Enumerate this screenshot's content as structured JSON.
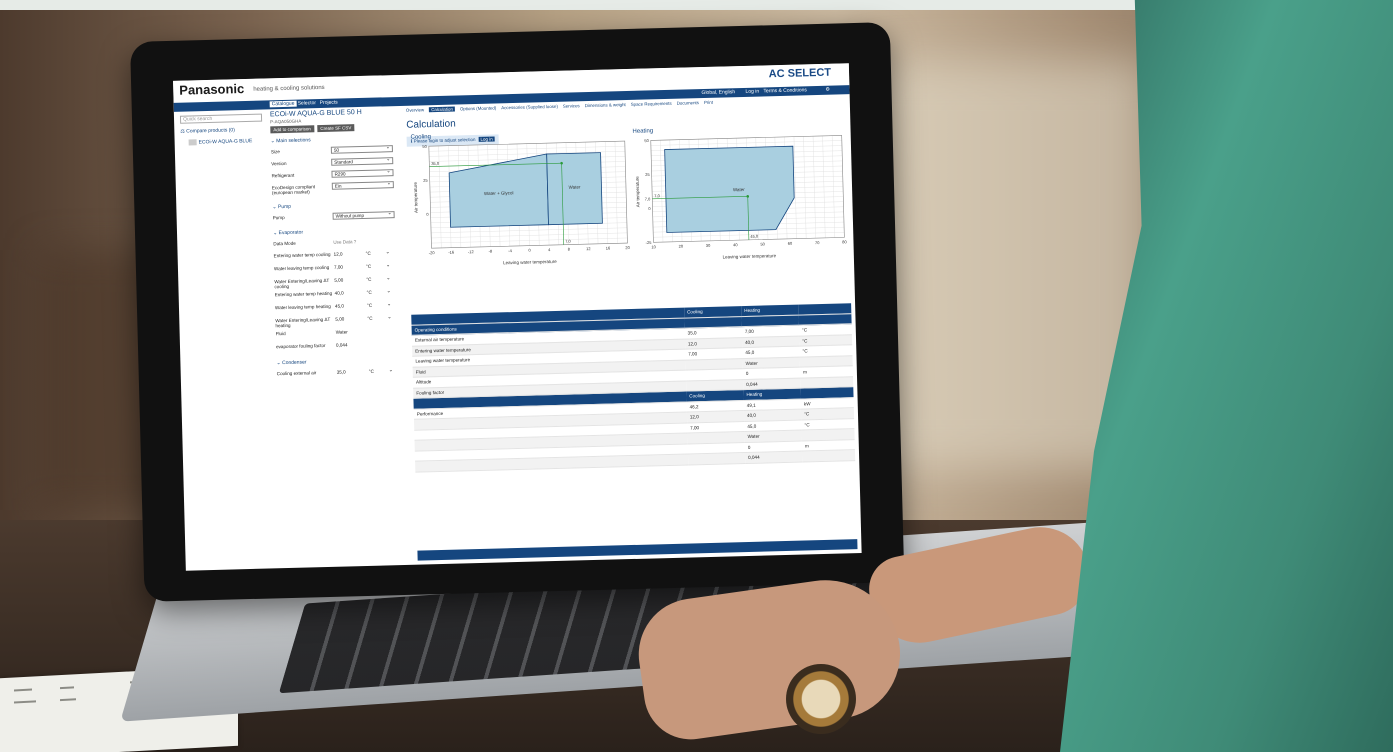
{
  "brand": {
    "logo": "Panasonic",
    "tagline": "heating & cooling solutions",
    "app_name": "AC SELECT"
  },
  "top_nav": {
    "tabs": [
      "Catalogue",
      "Selector",
      "Projects"
    ],
    "right_links": [
      "Global, English",
      "Log in",
      "Terms & Conditions"
    ]
  },
  "left_panel": {
    "search_placeholder": "Quick search",
    "compare_link": "Compare products (0)",
    "product_item": "ECOi-W AQUA-G BLUE"
  },
  "product": {
    "title": "ECOi-W AQUA-G BLUE 50 H",
    "code": "P-AQA050GHA",
    "buttons": [
      "Add to comparison",
      "Create SF CSV"
    ],
    "main_section": "Main selections",
    "fields": [
      {
        "label": "Size",
        "value": "50"
      },
      {
        "label": "Version",
        "value": "Standard"
      },
      {
        "label": "Refrigerant",
        "value": "R290"
      },
      {
        "label": "EcoDesign compliant (european market)",
        "value": "Ein"
      }
    ],
    "pump_section": "Pump",
    "pump": {
      "label": "Pump",
      "value": "Without pump"
    },
    "evaporator_section": "Evaporator",
    "evaporator_header": {
      "label": "Data Mode",
      "value": "Use Data ?"
    },
    "evaporator_rows": [
      {
        "label": "Entering water temp cooling",
        "value": "12,0",
        "unit": "°C"
      },
      {
        "label": "Water leaving temp cooling",
        "value": "7,00",
        "unit": "°C"
      },
      {
        "label": "Water Entering/Leaving ΔT cooling",
        "value": "5,00",
        "unit": "°C"
      },
      {
        "label": "Entering water temp heating",
        "value": "40,0",
        "unit": "°C"
      },
      {
        "label": "Water leaving temp heating",
        "value": "45,0",
        "unit": "°C"
      },
      {
        "label": "Water Entering/Leaving ΔT heating",
        "value": "5,00",
        "unit": "°C"
      },
      {
        "label": "Fluid",
        "value": "Water",
        "unit": ""
      },
      {
        "label": "evaporator fouling factor",
        "value": "0,044",
        "unit": ""
      }
    ],
    "condenser_section": "Condenser",
    "condenser_rows": [
      {
        "label": "Cooling external air",
        "value": "35,0",
        "unit": "°C"
      }
    ]
  },
  "main_tabs": [
    "Overview",
    "Calculation",
    "Options (Mounted)",
    "Accessories (Supplied loose)",
    "Services",
    "Dimensions & weight",
    "Space Requirements",
    "Documents",
    "Print"
  ],
  "active_tab": "Calculation",
  "calculation": {
    "heading": "Calculation",
    "login_notice": "Please login to adjust selection",
    "login_button": "Log in"
  },
  "chart_data": [
    {
      "type": "area",
      "title": "Cooling",
      "xlabel": "Leaving water temperature",
      "ylabel": "Air temperature",
      "xlim": [
        -20,
        20
      ],
      "ylim": [
        -25,
        50
      ],
      "x_ticks": [
        "-20",
        "-16",
        "-12",
        "-8",
        "-4",
        "0",
        "4",
        "8",
        "12",
        "16",
        "20"
      ],
      "y_ticks": [
        "50",
        "25",
        "0"
      ],
      "y_marker_label": "35,0",
      "x_marker_label": "7,0",
      "regions": [
        {
          "name": "Water + Glycol",
          "points": [
            [
              -16,
              30
            ],
            [
              4,
              42
            ],
            [
              4,
              -10
            ],
            [
              -16,
              -10
            ]
          ]
        },
        {
          "name": "Water",
          "points": [
            [
              4,
              42
            ],
            [
              15,
              42
            ],
            [
              15,
              -10
            ],
            [
              4,
              -10
            ]
          ]
        }
      ],
      "operating_point": {
        "x": 7,
        "y": 35
      }
    },
    {
      "type": "area",
      "title": "Heating",
      "xlabel": "Leaving water temperature",
      "ylabel": "Air temperature",
      "xlim": [
        10,
        80
      ],
      "ylim": [
        -25,
        50
      ],
      "x_ticks": [
        "10",
        "20",
        "30",
        "40",
        "50",
        "60",
        "70",
        "80"
      ],
      "y_ticks": [
        "50",
        "25",
        "7,0",
        "0",
        "-25"
      ],
      "y_marker_label": "7,0",
      "x_marker_label": "45,0",
      "regions": [
        {
          "name": "Water",
          "points": [
            [
              15,
              43
            ],
            [
              62,
              43
            ],
            [
              62,
              5
            ],
            [
              55,
              -18
            ],
            [
              15,
              -18
            ]
          ]
        }
      ],
      "operating_point": {
        "x": 45,
        "y": 7
      }
    }
  ],
  "results": {
    "col_headers": [
      "Cooling",
      "Heating"
    ],
    "rows1": [
      {
        "label": "Operating conditions",
        "cooling": "",
        "heating": "",
        "unit": "",
        "header": true
      },
      {
        "label": "External air temperature",
        "cooling": "35,0",
        "heating": "7,00",
        "unit": "°C"
      },
      {
        "label": "Entering water temperature",
        "cooling": "12,0",
        "heating": "40,0",
        "unit": "°C"
      },
      {
        "label": "Leaving water temperature",
        "cooling": "7,00",
        "heating": "45,0",
        "unit": "°C"
      },
      {
        "label": "Fluid",
        "cooling": "",
        "heating": "Water",
        "unit": ""
      },
      {
        "label": "Altitude",
        "cooling": "",
        "heating": "0",
        "unit": "m"
      },
      {
        "label": "Fouling factor",
        "cooling": "",
        "heating": "0,044",
        "unit": ""
      }
    ],
    "rows2": [
      {
        "label": "Performance",
        "cooling": "46,2",
        "heating": "49,1",
        "unit": "kW"
      },
      {
        "label": "",
        "cooling": "12,0",
        "heating": "40,0",
        "unit": "°C"
      },
      {
        "label": "",
        "cooling": "7,00",
        "heating": "45,0",
        "unit": "°C"
      },
      {
        "label": "",
        "cooling": "",
        "heating": "Water",
        "unit": ""
      },
      {
        "label": "",
        "cooling": "",
        "heating": "0",
        "unit": "m"
      },
      {
        "label": "",
        "cooling": "",
        "heating": "0,044",
        "unit": ""
      }
    ]
  }
}
